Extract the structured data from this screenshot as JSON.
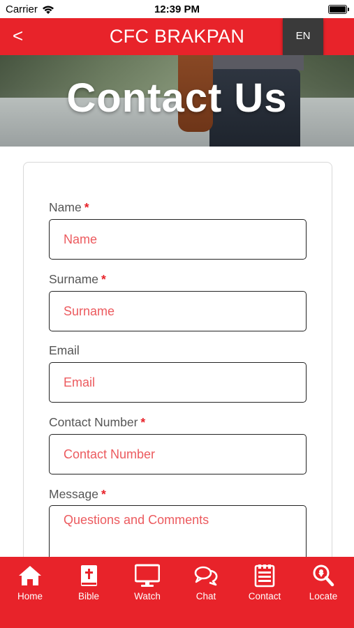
{
  "status_bar": {
    "carrier": "Carrier",
    "time": "12:39 PM",
    "battery_level": 1.0
  },
  "header": {
    "back_label": "<",
    "title": "CFC BRAKPAN",
    "language": "EN"
  },
  "hero": {
    "title": "Contact Us"
  },
  "form": {
    "required_marker": "*",
    "fields": [
      {
        "label": "Name",
        "placeholder": "Name",
        "required": true
      },
      {
        "label": "Surname",
        "placeholder": "Surname",
        "required": true
      },
      {
        "label": "Email",
        "placeholder": "Email",
        "required": false
      },
      {
        "label": "Contact Number",
        "placeholder": "Contact Number",
        "required": true
      },
      {
        "label": "Message",
        "placeholder": "Questions and Comments",
        "required": true
      }
    ]
  },
  "bottom_nav": {
    "items": [
      {
        "label": "Home",
        "icon": "home-icon"
      },
      {
        "label": "Bible",
        "icon": "bible-icon"
      },
      {
        "label": "Watch",
        "icon": "monitor-icon"
      },
      {
        "label": "Chat",
        "icon": "chat-icon"
      },
      {
        "label": "Contact",
        "icon": "contact-form-icon"
      },
      {
        "label": "Locate",
        "icon": "locate-search-icon"
      }
    ]
  },
  "colors": {
    "brand_red": "#e8232a",
    "lang_button": "#3a3a3a",
    "placeholder_red": "#ec5a5e"
  }
}
